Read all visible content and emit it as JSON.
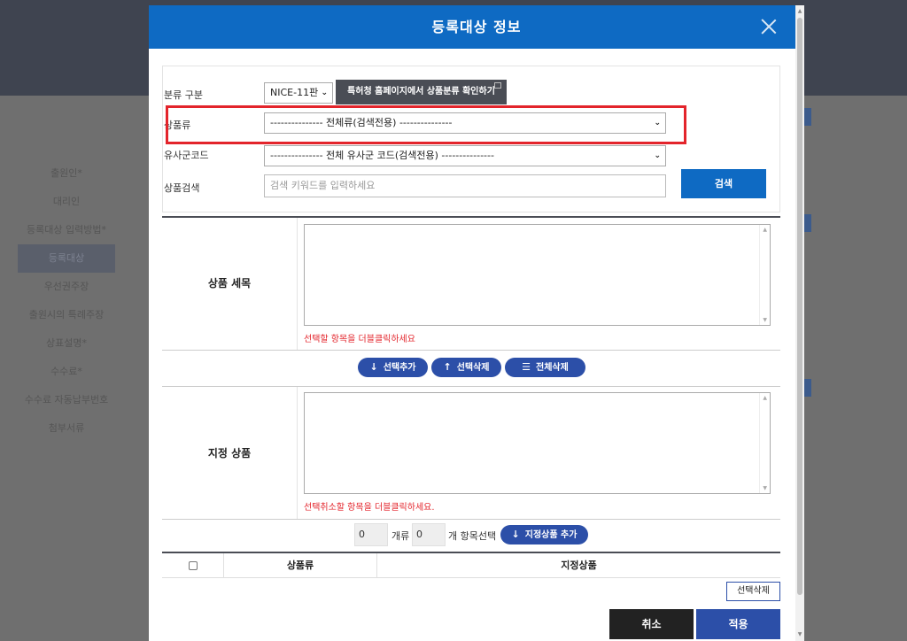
{
  "background": {
    "sidebar": [
      "출원인*",
      "대리인",
      "등록대상 입력방법*",
      "등록대상",
      "우선권주장",
      "출원시의 특례주장",
      "상표설명*",
      "수수료*",
      "수수료 자동납부번호",
      "첨부서류"
    ],
    "active_index": 3
  },
  "modal": {
    "title": "등록대상 정보",
    "search": {
      "class_type_label": "분류 구분",
      "class_type_value": "NICE-11판",
      "patent_site_button": "특허청 홈페이지에서 상품분류 확인하기",
      "product_class_label": "상품류",
      "product_class_value": "--------------- 전체류(검색전용) ---------------",
      "similar_group_label": "유사군코드",
      "similar_group_value": "--------------- 전체 유사군 코드(검색전용) ---------------",
      "product_search_label": "상품검색",
      "product_search_placeholder": "검색 키워드를 입력하세요",
      "search_button": "검색"
    },
    "products": {
      "label": "상품 세목",
      "hint": "선택할 항목을 더블클릭하세요"
    },
    "actions": {
      "add": "선택추가",
      "remove": "선택삭제",
      "remove_all": "전체삭제"
    },
    "designated": {
      "label": "지정 상품",
      "hint": "선택취소할 항목을 더블클릭하세요."
    },
    "summary": {
      "class_count": "0",
      "class_unit": "개류",
      "item_count": "0",
      "item_unit": "개 항목선택",
      "add_button": "지정상품 추가"
    },
    "grid": {
      "columns": [
        "상품류",
        "지정상품"
      ]
    },
    "delete_selected": "선택삭제",
    "cancel": "취소",
    "apply": "적용"
  },
  "colors": {
    "header_blue": "#0e6ac3",
    "pill_blue": "#2c4fa8",
    "highlight_red": "#e3242b"
  }
}
